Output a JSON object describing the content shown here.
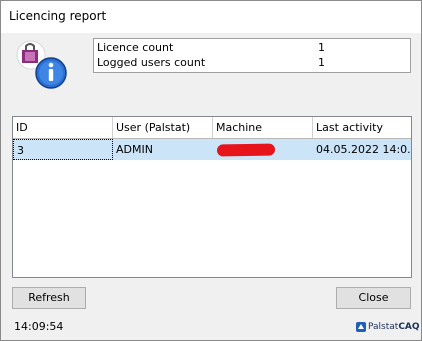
{
  "window": {
    "title": "Licencing report"
  },
  "info": {
    "rows": [
      {
        "label": "Licence count",
        "value": "1"
      },
      {
        "label": "Logged users count",
        "value": "1"
      }
    ]
  },
  "grid": {
    "columns": [
      "ID",
      "User (Palstat)",
      "Machine",
      "Last activity"
    ],
    "rows": [
      {
        "id": "3",
        "user": "ADMIN",
        "machine": "",
        "last_activity": "04.05.2022 14:0..."
      }
    ]
  },
  "buttons": {
    "refresh": "Refresh",
    "close": "Close"
  },
  "status": {
    "time": "14:09:54"
  },
  "logo": {
    "name_a": "Palstat",
    "name_b": "CAQ"
  },
  "colors": {
    "selection": "#cce4f7",
    "redaction": "#e8141c",
    "info_icon": "#1f5fb8"
  }
}
